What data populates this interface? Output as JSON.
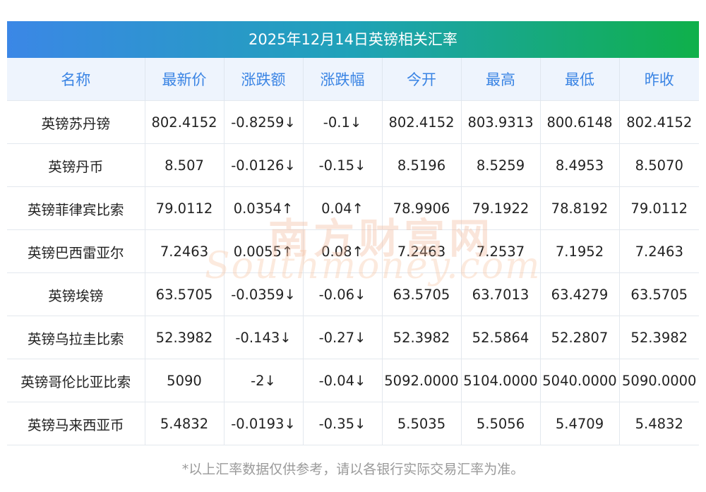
{
  "title": "2025年12月14日英镑相关汇率",
  "columns": [
    "名称",
    "最新价",
    "涨跌额",
    "涨跌幅",
    "今开",
    "最高",
    "最低",
    "昨收"
  ],
  "rows": [
    {
      "name": "英镑苏丹镑",
      "latest": "802.4152",
      "change": "-0.8259↓",
      "pct": "-0.1↓",
      "open": "802.4152",
      "high": "803.9313",
      "low": "800.6148",
      "prev": "802.4152",
      "dir": "down"
    },
    {
      "name": "英镑丹币",
      "latest": "8.507",
      "change": "-0.0126↓",
      "pct": "-0.15↓",
      "open": "8.5196",
      "high": "8.5259",
      "low": "8.4953",
      "prev": "8.5070",
      "dir": "down"
    },
    {
      "name": "英镑菲律宾比索",
      "latest": "79.0112",
      "change": "0.0354↑",
      "pct": "0.04↑",
      "open": "78.9906",
      "high": "79.1922",
      "low": "78.8192",
      "prev": "79.0112",
      "dir": "up"
    },
    {
      "name": "英镑巴西雷亚尔",
      "latest": "7.2463",
      "change": "0.0055↑",
      "pct": "0.08↑",
      "open": "7.2463",
      "high": "7.2537",
      "low": "7.1952",
      "prev": "7.2463",
      "dir": "up"
    },
    {
      "name": "英镑埃镑",
      "latest": "63.5705",
      "change": "-0.0359↓",
      "pct": "-0.06↓",
      "open": "63.5705",
      "high": "63.7013",
      "low": "63.4279",
      "prev": "63.5705",
      "dir": "down"
    },
    {
      "name": "英镑乌拉圭比索",
      "latest": "52.3982",
      "change": "-0.143↓",
      "pct": "-0.27↓",
      "open": "52.3982",
      "high": "52.5864",
      "low": "52.2807",
      "prev": "52.3982",
      "dir": "down"
    },
    {
      "name": "英镑哥伦比亚比索",
      "latest": "5090",
      "change": "-2↓",
      "pct": "-0.04↓",
      "open": "5092.0000",
      "high": "5104.0000",
      "low": "5040.0000",
      "prev": "5090.0000",
      "dir": "down"
    },
    {
      "name": "英镑马来西亚币",
      "latest": "5.4832",
      "change": "-0.0193↓",
      "pct": "-0.35↓",
      "open": "5.5035",
      "high": "5.5056",
      "low": "5.4709",
      "prev": "5.4832",
      "dir": "down"
    }
  ],
  "watermark": {
    "cn": "南方财富网",
    "en": "Southmoney.com"
  },
  "footer": "*以上汇率数据仅供参考，请以各银行实际交易汇率为准。",
  "colors": {
    "up": "#e01010",
    "down": "#1f8a1f",
    "header_text": "#3a84e4",
    "header_bg": "#eef4fd"
  }
}
